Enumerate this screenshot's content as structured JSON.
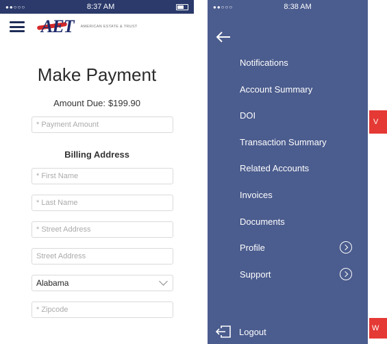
{
  "left": {
    "status": {
      "time": "8:37 AM",
      "signal": "●●○○○"
    },
    "header": {
      "logo_mark": "AET",
      "logo_text": "AMERICAN ESTATE & TRUST"
    },
    "title": "Make Payment",
    "amount_due": {
      "label": "Amount Due:",
      "value": "$199.90"
    },
    "payment_amount_placeholder": "* Payment Amount",
    "billing_heading": "Billing Address",
    "fields": {
      "first_name": "* First Name",
      "last_name": "* Last Name",
      "street1": "* Street Address",
      "street2": "Street Address"
    },
    "state_select": "Alabama",
    "zipcode": "* Zipcode"
  },
  "right": {
    "status": {
      "time": "8:38 AM",
      "signal": "●●○○○"
    },
    "menu": [
      {
        "label": "Notifications"
      },
      {
        "label": "Account Summary"
      },
      {
        "label": "DOI"
      },
      {
        "label": "Transaction Summary"
      },
      {
        "label": "Related Accounts"
      },
      {
        "label": "Invoices"
      },
      {
        "label": "Documents"
      },
      {
        "label": "Profile",
        "has_chevron": true
      },
      {
        "label": "Support",
        "has_chevron": true
      }
    ],
    "logout": "Logout",
    "behind_tab_1": "V",
    "behind_tab_2": "W"
  },
  "colors": {
    "statusbar": "#2b3a6b",
    "drawer": "#4b5c8e",
    "accent_red": "#e53935",
    "logo_blue": "#1f2b6b"
  }
}
